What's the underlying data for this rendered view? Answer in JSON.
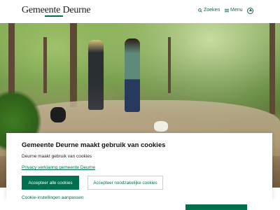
{
  "header": {
    "logo_text": "Gemeente Deurne",
    "search_label": "Zoeken",
    "menu_label": "Menu",
    "icons": {
      "search": "search-icon",
      "menu": "menu-icon",
      "accessibility": "accessibility-icon"
    }
  },
  "hero": {
    "image_alt": "Twee vrouwen wandelen met honden in het bos"
  },
  "cookie_modal": {
    "title": "Gemeente Deurne maakt gebruik van cookies",
    "text": "Deurne maakt gebruik van cookies",
    "privacy_link": "Privacy verklaring gemeente Deurne",
    "accept_all": "Accepteer alle cookies",
    "accept_necessary": "Accepteer noodzakelijke cookies",
    "settings_link": "Cookie-instellingen aanpassen"
  },
  "colors": {
    "brand_green": "#00704f",
    "text_dark": "#111111"
  }
}
